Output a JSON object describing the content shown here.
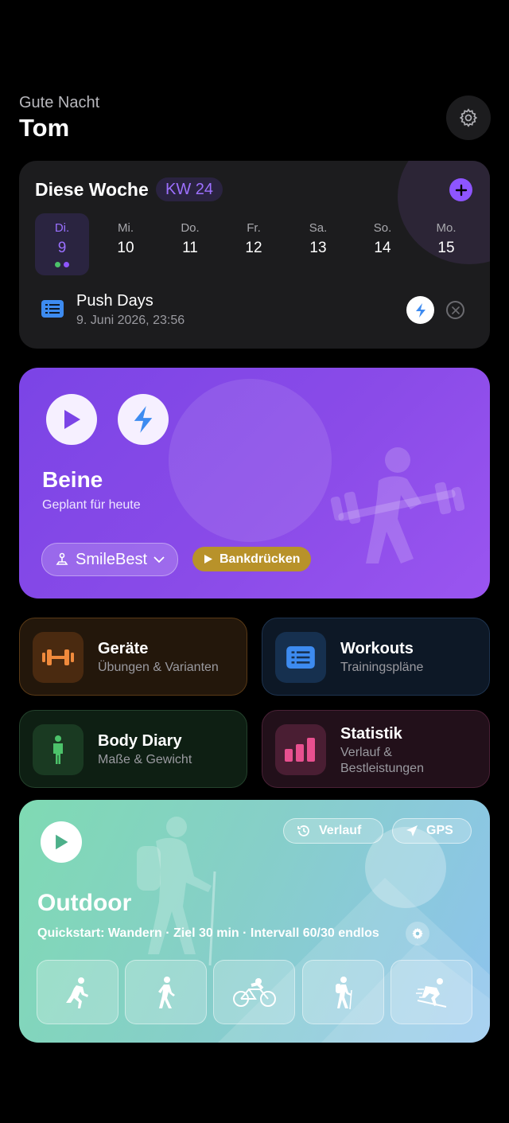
{
  "header": {
    "greeting": "Gute Nacht",
    "name": "Tom",
    "settings_icon": "gear-icon"
  },
  "week": {
    "title": "Diese Woche",
    "kw": "KW 24",
    "days": [
      {
        "name": "Di.",
        "date": "9",
        "selected": true
      },
      {
        "name": "Mi.",
        "date": "10"
      },
      {
        "name": "Do.",
        "date": "11"
      },
      {
        "name": "Fr.",
        "date": "12"
      },
      {
        "name": "Sa.",
        "date": "13"
      },
      {
        "name": "So.",
        "date": "14"
      },
      {
        "name": "Mo.",
        "date": "15"
      }
    ],
    "entry": {
      "title": "Push Days",
      "date": "9. Juni 2026, 23:56"
    },
    "accent_color": "#8e55ff"
  },
  "hero": {
    "title": "Beine",
    "subtitle": "Geplant für heute",
    "user": "SmileBest",
    "exercise": "Bankdrücken"
  },
  "tiles": {
    "geraete": {
      "title": "Geräte",
      "sub": "Übungen & Varianten",
      "color": "#f08a3c"
    },
    "workouts": {
      "title": "Workouts",
      "sub": "Trainingspläne",
      "color": "#3d8bf0"
    },
    "body": {
      "title": "Body Diary",
      "sub": "Maße & Gewicht",
      "color": "#4cc26a"
    },
    "stat": {
      "title": "Statistik",
      "sub1": "Verlauf &",
      "sub2": "Bestleistungen",
      "color": "#e8508f"
    }
  },
  "outdoor": {
    "title": "Outdoor",
    "history": "Verlauf",
    "gps": "GPS",
    "quickstart": "Quickstart: Wandern · Ziel 30 min · Intervall 60/30 endlos",
    "activities": [
      "running-icon",
      "walking-icon",
      "cycling-icon",
      "hiking-icon",
      "skiing-icon"
    ]
  }
}
